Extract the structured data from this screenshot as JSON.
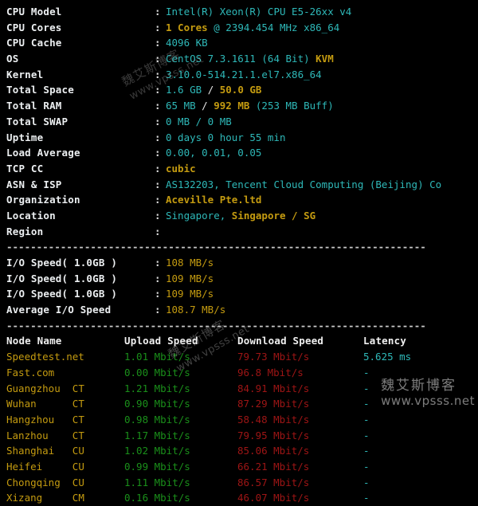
{
  "system_info": {
    "rows": [
      {
        "label": "CPU Model",
        "segments": [
          {
            "text": "Intel(R) Xeon(R) CPU E5-26xx v4",
            "color": "cyan",
            "bold": false
          }
        ]
      },
      {
        "label": "CPU Cores",
        "segments": [
          {
            "text": "1 Cores",
            "color": "yellow",
            "bold": true
          },
          {
            "text": " @ 2394.454 MHz x86_64",
            "color": "cyan",
            "bold": false
          }
        ]
      },
      {
        "label": "CPU Cache",
        "segments": [
          {
            "text": "4096 KB",
            "color": "cyan",
            "bold": false
          }
        ]
      },
      {
        "label": "OS",
        "segments": [
          {
            "text": "CentOS 7.3.1611 (64 Bit) ",
            "color": "cyan",
            "bold": false
          },
          {
            "text": "KVM",
            "color": "yellow",
            "bold": true
          }
        ]
      },
      {
        "label": "Kernel",
        "segments": [
          {
            "text": "3.10.0-514.21.1.el7.x86_64",
            "color": "cyan",
            "bold": false
          }
        ]
      },
      {
        "label": "Total Space",
        "segments": [
          {
            "text": "1.6 GB ",
            "color": "cyan",
            "bold": false
          },
          {
            "text": "/ ",
            "color": "white",
            "bold": false
          },
          {
            "text": "50.0 GB",
            "color": "yellow",
            "bold": true
          }
        ]
      },
      {
        "label": "Total RAM",
        "segments": [
          {
            "text": "65 MB ",
            "color": "cyan",
            "bold": false
          },
          {
            "text": "/ ",
            "color": "white",
            "bold": false
          },
          {
            "text": "992 MB",
            "color": "yellow",
            "bold": true
          },
          {
            "text": " (253 MB Buff)",
            "color": "cyan",
            "bold": false
          }
        ]
      },
      {
        "label": "Total SWAP",
        "segments": [
          {
            "text": "0 MB / 0 MB",
            "color": "cyan",
            "bold": false
          }
        ]
      },
      {
        "label": "Uptime",
        "segments": [
          {
            "text": "0 days 0 hour 55 min",
            "color": "cyan",
            "bold": false
          }
        ]
      },
      {
        "label": "Load Average",
        "segments": [
          {
            "text": "0.00, 0.01, 0.05",
            "color": "cyan",
            "bold": false
          }
        ]
      },
      {
        "label": "TCP CC",
        "segments": [
          {
            "text": "cubic",
            "color": "yellow",
            "bold": true
          }
        ]
      },
      {
        "label": "ASN & ISP",
        "segments": [
          {
            "text": "AS132203, Tencent Cloud Computing (Beijing) Co",
            "color": "cyan",
            "bold": false
          }
        ]
      },
      {
        "label": "Organization",
        "segments": [
          {
            "text": "Aceville Pte.ltd",
            "color": "yellow",
            "bold": true
          }
        ]
      },
      {
        "label": "Location",
        "segments": [
          {
            "text": "Singapore, ",
            "color": "cyan",
            "bold": false
          },
          {
            "text": "Singapore / SG",
            "color": "yellow",
            "bold": true
          }
        ]
      },
      {
        "label": "Region",
        "segments": [
          {
            "text": "",
            "color": "cyan",
            "bold": false
          }
        ]
      }
    ]
  },
  "separator": "----------------------------------------------------------------------",
  "io_test": {
    "rows": [
      {
        "label": "I/O Speed( 1.0GB )",
        "value": "108 MB/s"
      },
      {
        "label": "I/O Speed( 1.0GB )",
        "value": "109 MB/s"
      },
      {
        "label": "I/O Speed( 1.0GB )",
        "value": "109 MB/s"
      },
      {
        "label": "Average I/O Speed",
        "value": "108.7 MB/s"
      }
    ]
  },
  "speedtest": {
    "headers": {
      "node": "Node Name",
      "upload": "Upload Speed",
      "download": "Download Speed",
      "latency": "Latency"
    },
    "rows": [
      {
        "node": "Speedtest.net",
        "isp": "",
        "upload": "1.01 Mbit/s",
        "download": "79.73 Mbit/s",
        "latency": "5.625 ms"
      },
      {
        "node": "Fast.com",
        "isp": "",
        "upload": "0.00 Mbit/s",
        "download": "96.8 Mbit/s",
        "latency": "-"
      },
      {
        "node": "Guangzhou",
        "isp": "CT",
        "upload": "1.21 Mbit/s",
        "download": "84.91 Mbit/s",
        "latency": "-"
      },
      {
        "node": "Wuhan",
        "isp": "CT",
        "upload": "0.90 Mbit/s",
        "download": "87.29 Mbit/s",
        "latency": "-"
      },
      {
        "node": "Hangzhou",
        "isp": "CT",
        "upload": "0.98 Mbit/s",
        "download": "58.48 Mbit/s",
        "latency": "-"
      },
      {
        "node": "Lanzhou",
        "isp": "CT",
        "upload": "1.17 Mbit/s",
        "download": "79.95 Mbit/s",
        "latency": "-"
      },
      {
        "node": "Shanghai",
        "isp": "CU",
        "upload": "1.02 Mbit/s",
        "download": "85.06 Mbit/s",
        "latency": "-"
      },
      {
        "node": "Heifei",
        "isp": "CU",
        "upload": "0.99 Mbit/s",
        "download": "66.21 Mbit/s",
        "latency": "-"
      },
      {
        "node": "Chongqing",
        "isp": "CU",
        "upload": "1.11 Mbit/s",
        "download": "86.57 Mbit/s",
        "latency": "-"
      },
      {
        "node": "Xizang",
        "isp": "CM",
        "upload": "0.16 Mbit/s",
        "download": "46.07 Mbit/s",
        "latency": "-"
      }
    ]
  },
  "watermarks": {
    "diagonal_cn": "魏艾斯博客",
    "diagonal_en": "www.vpsss.net",
    "corner_cn": "魏艾斯博客",
    "corner_en": "www.vpsss.net"
  },
  "colors": {
    "background": "#000000",
    "label": "#eceff1",
    "cyan": "#2eb8b8",
    "yellow": "#c49b10",
    "green": "#1a8f1a",
    "red": "#9e1515"
  }
}
